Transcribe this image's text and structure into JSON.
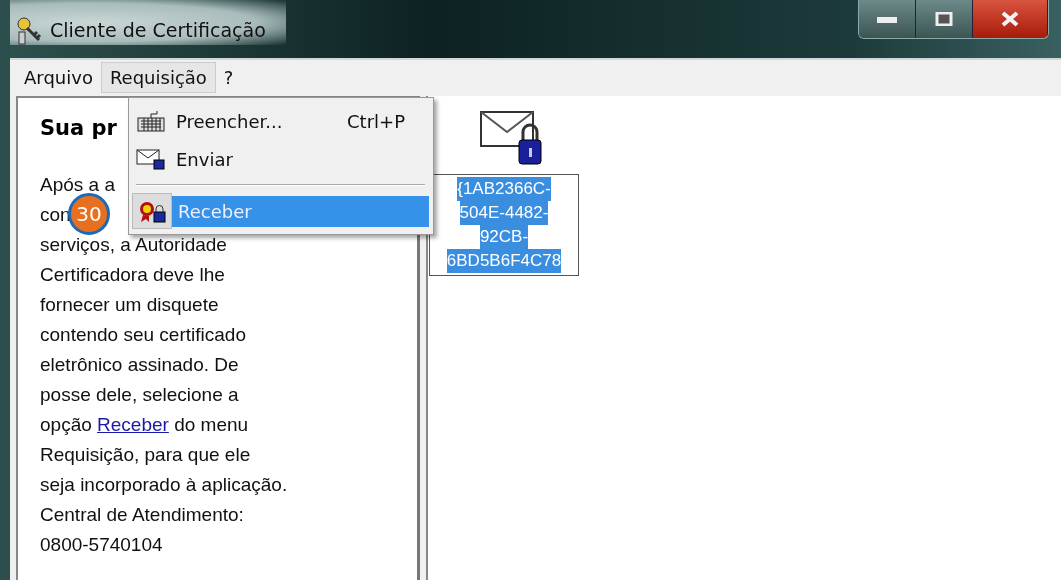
{
  "window": {
    "title": "Cliente de Certificação"
  },
  "menu_bar": [
    {
      "label": "Arquivo",
      "selected": false
    },
    {
      "label": "Requisição",
      "selected": true
    },
    {
      "label": "?",
      "selected": false
    }
  ],
  "menu": {
    "items": [
      {
        "kind": "item",
        "label": "Preencher...",
        "shortcut": "Ctrl+P",
        "selected": false
      },
      {
        "kind": "item",
        "label": "Enviar",
        "selected": false
      },
      {
        "kind": "separator"
      },
      {
        "kind": "item",
        "label": "Receber",
        "selected": true
      }
    ]
  },
  "left_panel": {
    "heading": "Sua pr",
    "lines": [
      [
        {
          "text": "Após a a"
        }
      ],
      [
        {
          "text": "con"
        }
      ],
      [
        {
          "text": "serviços, a Autoridade"
        }
      ],
      [
        {
          "text": "Certificadora deve lhe"
        }
      ],
      [
        {
          "text": "fornecer um disquete"
        }
      ],
      [
        {
          "text": "contendo seu certificado"
        }
      ],
      [
        {
          "text": "eletrônico assinado. De"
        }
      ],
      [
        {
          "text": "posse dele, selecione a"
        }
      ],
      [
        {
          "text": "opção "
        },
        {
          "text": "Receber",
          "link": true
        },
        {
          "text": " do menu"
        }
      ],
      [
        {
          "text": "Requisição, para que ele"
        }
      ],
      [
        {
          "text": "seja incorporado à aplicação."
        }
      ],
      [
        {
          "text": "Central de Atendimento:"
        }
      ],
      [
        {
          "text": "0800-5740104"
        }
      ]
    ]
  },
  "files": [
    {
      "lines": [
        "{1AB2366C-",
        "504E-4482-",
        "92CB-",
        "6BD5B6F4C78"
      ],
      "selected": true
    }
  ],
  "callout": {
    "number": "30"
  }
}
